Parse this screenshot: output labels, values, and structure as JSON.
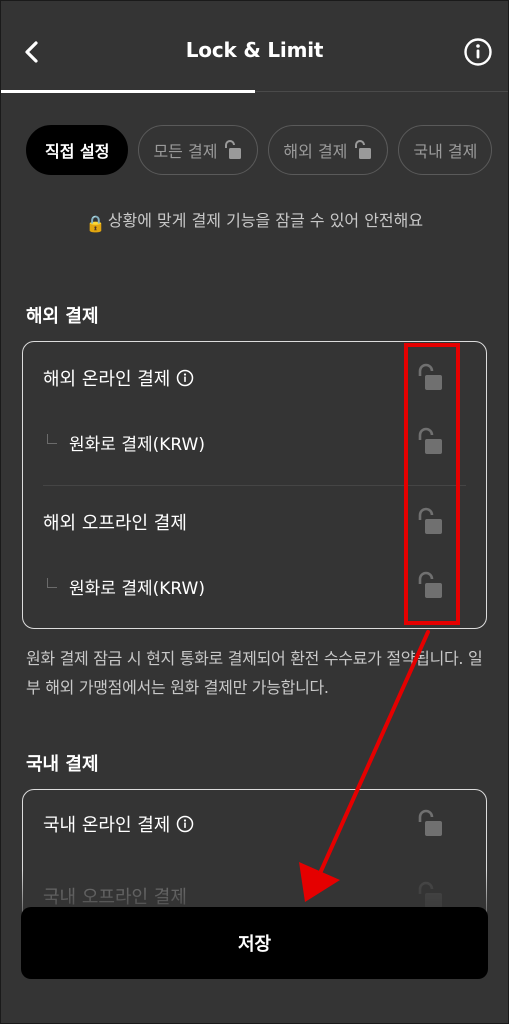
{
  "header": {
    "title": "Lock & Limit",
    "back_icon": "chevron-left-icon",
    "info_icon": "info-circle-icon"
  },
  "chips": [
    {
      "label": "직접 설정",
      "active": true
    },
    {
      "label": "모든 결제",
      "active": false
    },
    {
      "label": "해외 결제",
      "active": false
    },
    {
      "label": "국내 결제",
      "active": false
    }
  ],
  "notice": {
    "emoji": "🔒",
    "text": "상황에 맞게 결제 기능을 잠글 수 있어 안전해요"
  },
  "overseas": {
    "title": "해외 결제",
    "rows": [
      {
        "label": "해외 온라인 결제",
        "has_info": true,
        "locked": false
      },
      {
        "label": "원화로 결제(KRW)",
        "sub": true,
        "locked": false
      },
      {
        "label": "해외 오프라인 결제",
        "has_info": false,
        "locked": false
      },
      {
        "label": "원화로 결제(KRW)",
        "sub": true,
        "locked": false
      }
    ],
    "description": "원화 결제 잠금 시 현지 통화로 결제되어 환전 수수료가 절약됩니다. 일부 해외 가맹점에서는 원화 결제만 가능합니다."
  },
  "domestic": {
    "title": "국내 결제",
    "rows": [
      {
        "label": "국내 온라인 결제",
        "has_info": true,
        "locked": false
      },
      {
        "label": "국내 오프라인 결제",
        "has_info": false,
        "locked": false
      }
    ]
  },
  "save_label": "저장",
  "colors": {
    "background": "#343434",
    "button": "#000000",
    "annotation": "#e50000"
  }
}
